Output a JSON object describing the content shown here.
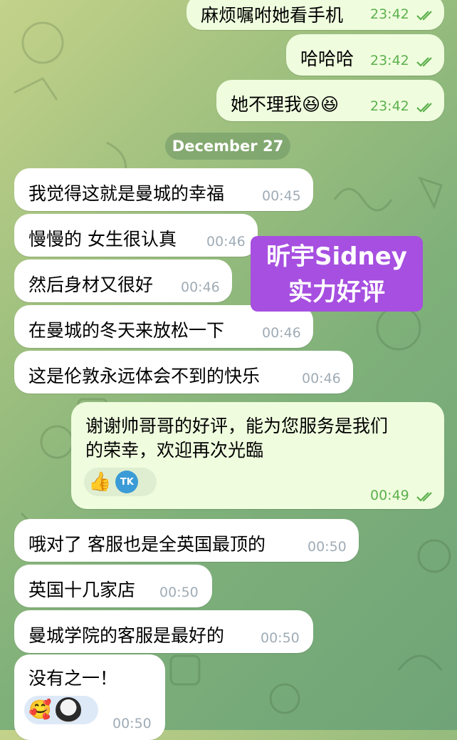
{
  "date_label": "December 27",
  "watermark": {
    "line1": "昕宇Sidney",
    "line2": "实力好评"
  },
  "messages": [
    {
      "text": "麻烦嘱咐她看手机",
      "time": "23:42",
      "dir": "out"
    },
    {
      "text": "哈哈哈",
      "time": "23:42",
      "dir": "out"
    },
    {
      "text": "她不理我😆😆",
      "time": "23:42",
      "dir": "out"
    },
    {
      "text": "我觉得这就是曼城的幸福",
      "time": "00:45",
      "dir": "in"
    },
    {
      "text": "慢慢的 女生很认真",
      "time": "00:46",
      "dir": "in"
    },
    {
      "text": "然后身材又很好",
      "time": "00:46",
      "dir": "in"
    },
    {
      "text": "在曼城的冬天来放松一下",
      "time": "00:46",
      "dir": "in"
    },
    {
      "text": "这是伦敦永远体会不到的快乐",
      "time": "00:46",
      "dir": "in"
    },
    {
      "text_line1": "谢谢帅哥哥的好评，能为您服务是我们",
      "text_line2": "的荣幸，欢迎再次光臨",
      "time": "00:49",
      "dir": "out",
      "reaction_emoji": "👍",
      "reaction_badge": "TK"
    },
    {
      "text": "哦对了 客服也是全英国最顶的",
      "time": "00:50",
      "dir": "in"
    },
    {
      "text": "英国十几家店",
      "time": "00:50",
      "dir": "in"
    },
    {
      "text": "曼城学院的客服是最好的",
      "time": "00:50",
      "dir": "in"
    },
    {
      "text": "没有之一！",
      "time": "00:50",
      "dir": "in",
      "reaction_emoji": "🥰"
    }
  ],
  "colors": {
    "incoming": "#ffffff",
    "outgoing": "#effdde",
    "check": "#5db04d",
    "watermark": "#a64fe0"
  }
}
